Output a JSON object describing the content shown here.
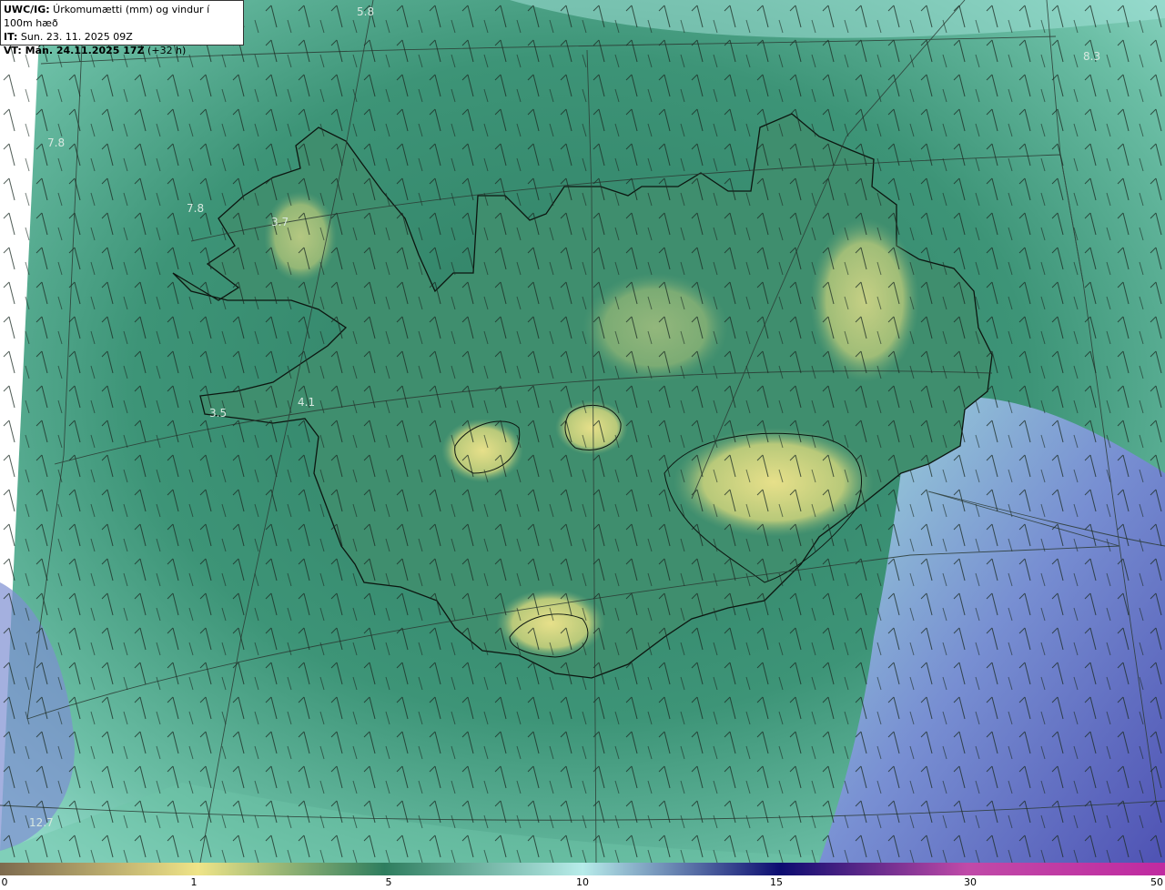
{
  "header": {
    "line1_bold": "UWC/IG:",
    "line1_rest": " Úrkomumætti (mm) og vindur í 100m hæð",
    "line2_bold": "IT:",
    "line2_rest": " Sun. 23. 11. 2025 09Z",
    "line3_bold": "VT: Mán. 24.11.2025 17Z",
    "line3_rest": " (+32 h)"
  },
  "map": {
    "value_labels": [
      "5.8",
      "8.3",
      "7.8",
      "7.8",
      "3.7",
      "4.1",
      "3.5",
      "12.7"
    ],
    "icons": [
      "wind-barb-icon",
      "coastline-iceland"
    ]
  },
  "colorbar": {
    "ticks": [
      "0",
      "1",
      "5",
      "10",
      "15",
      "30",
      "50"
    ],
    "colors": [
      "#7d6a4e",
      "#efe488",
      "#2e7d5e",
      "#b8ecea",
      "#0c0c70",
      "#c04aa8",
      "#c02aa0"
    ]
  }
}
